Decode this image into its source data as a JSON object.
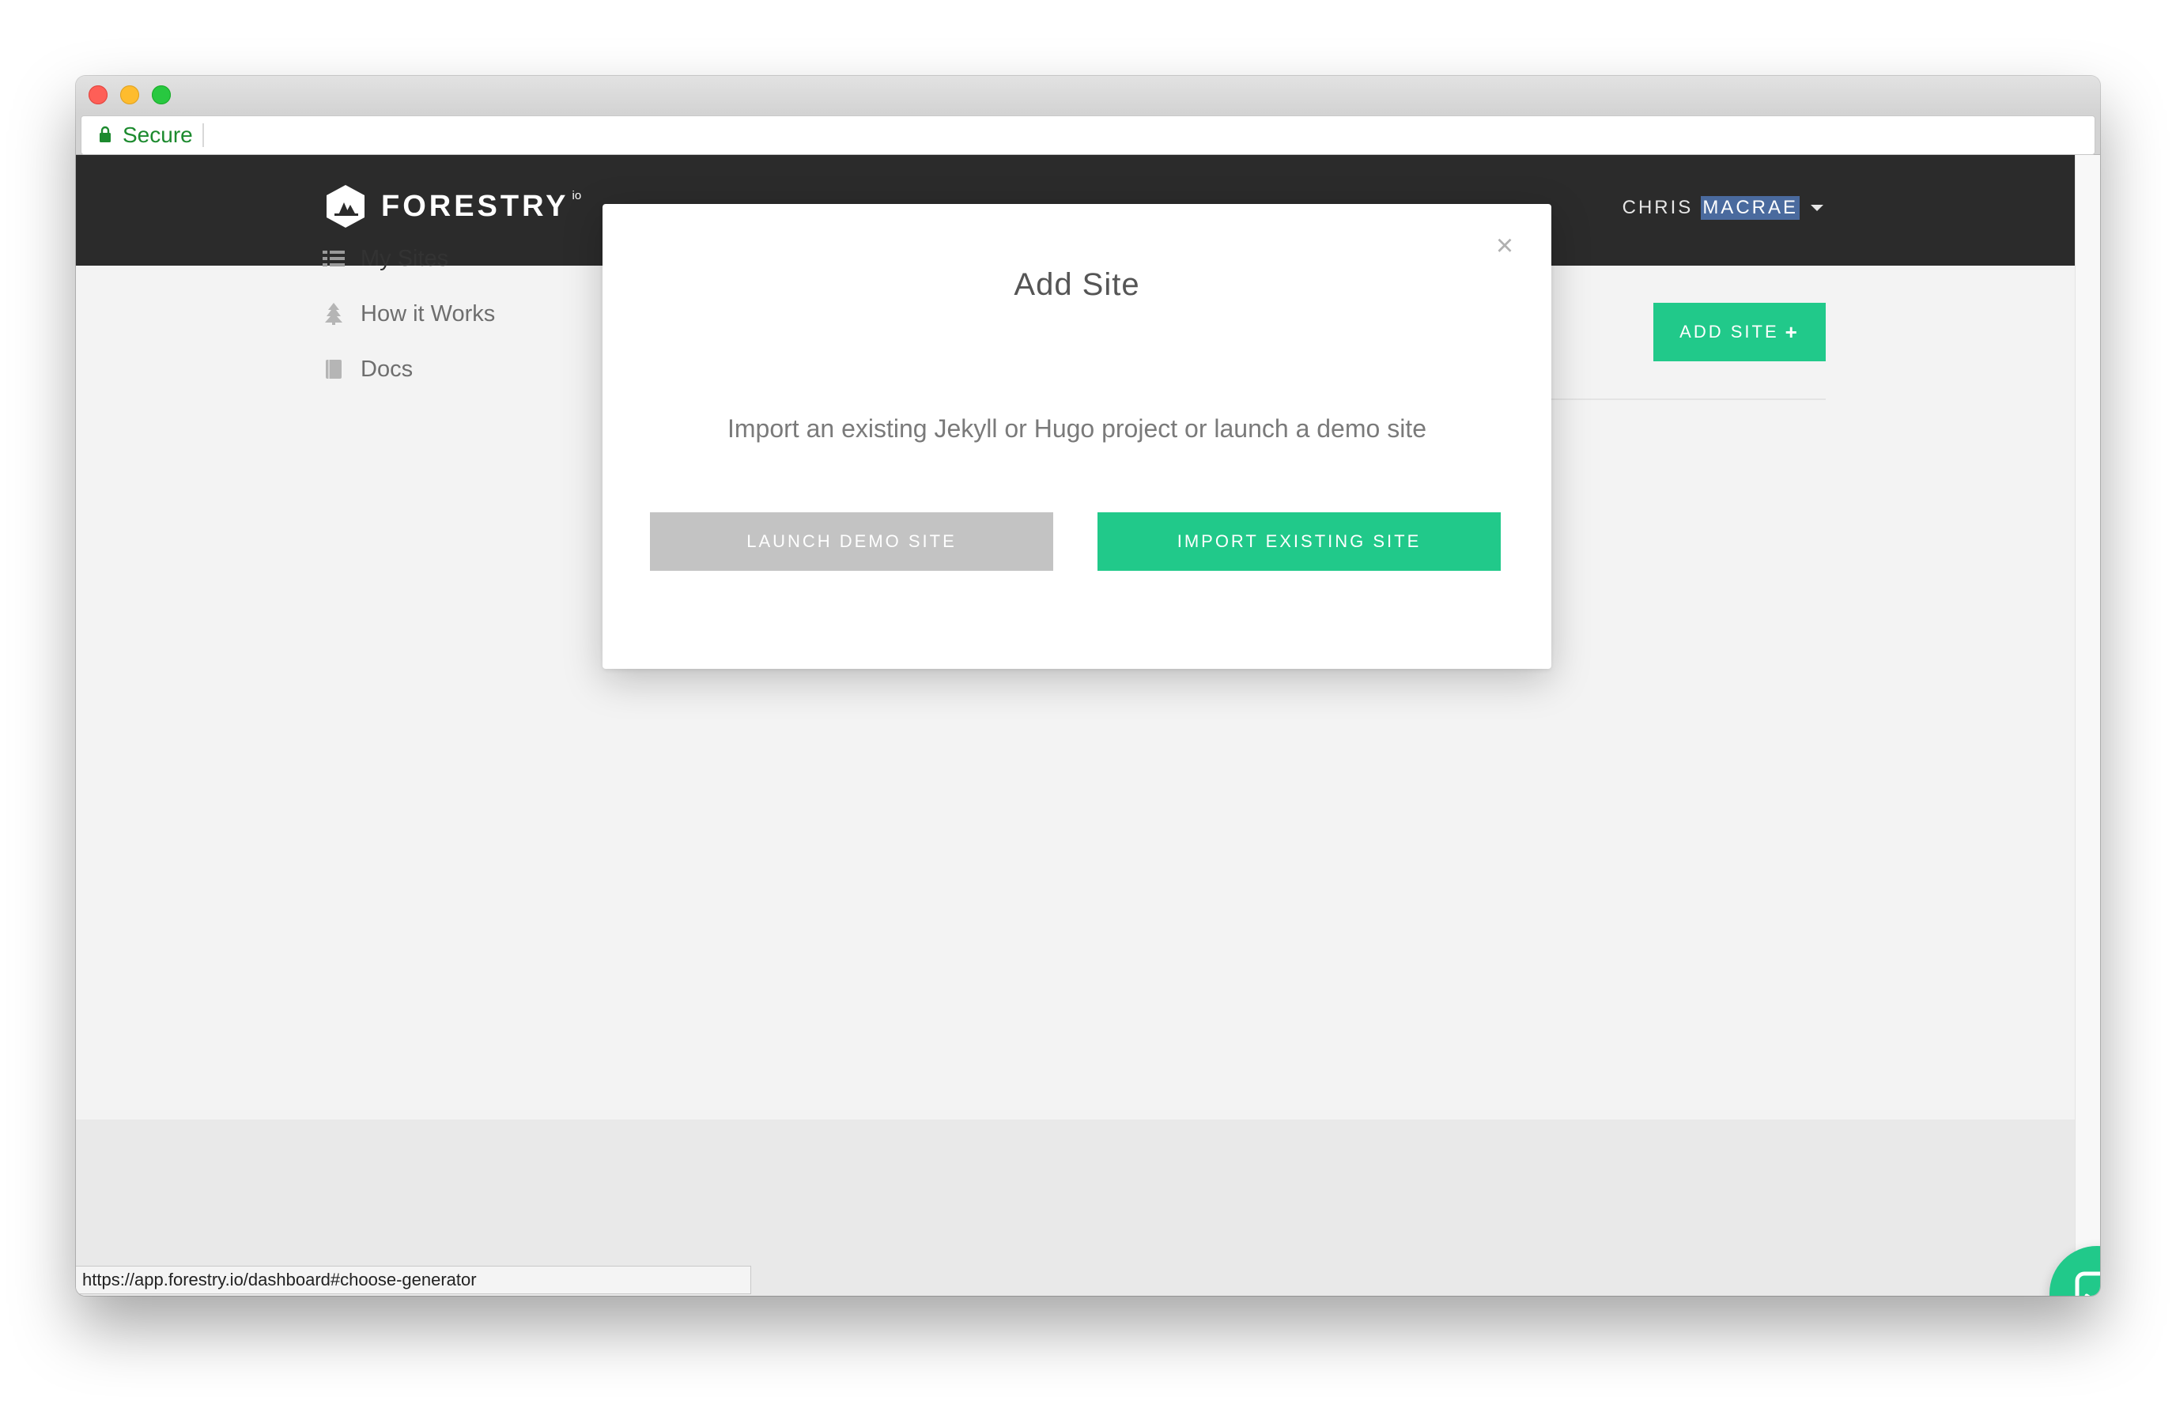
{
  "browser": {
    "secure_label": "Secure",
    "status_url": "https://app.forestry.io/dashboard#choose-generator"
  },
  "header": {
    "brand": "FORESTRY",
    "brand_suffix": "io",
    "user_first": "CHRIS",
    "user_last": "MACRAE"
  },
  "sidebar": {
    "items": [
      {
        "label": "My Sites",
        "icon": "list-icon",
        "active": true
      },
      {
        "label": "How it Works",
        "icon": "tree-icon",
        "active": false
      },
      {
        "label": "Docs",
        "icon": "book-icon",
        "active": false
      }
    ]
  },
  "main": {
    "add_site_label": "ADD SITE",
    "add_site_icon": "+"
  },
  "modal": {
    "close_icon": "×",
    "title": "Add Site",
    "text": "Import an existing Jekyll or Hugo project or launch a demo site",
    "demo_button": "LAUNCH DEMO SITE",
    "import_button": "IMPORT EXISTING SITE"
  },
  "colors": {
    "accent": "#21c98a",
    "header_bg": "#2b2b2b",
    "secondary_button": "#c3c3c3",
    "secure_green": "#1c8a2e"
  }
}
